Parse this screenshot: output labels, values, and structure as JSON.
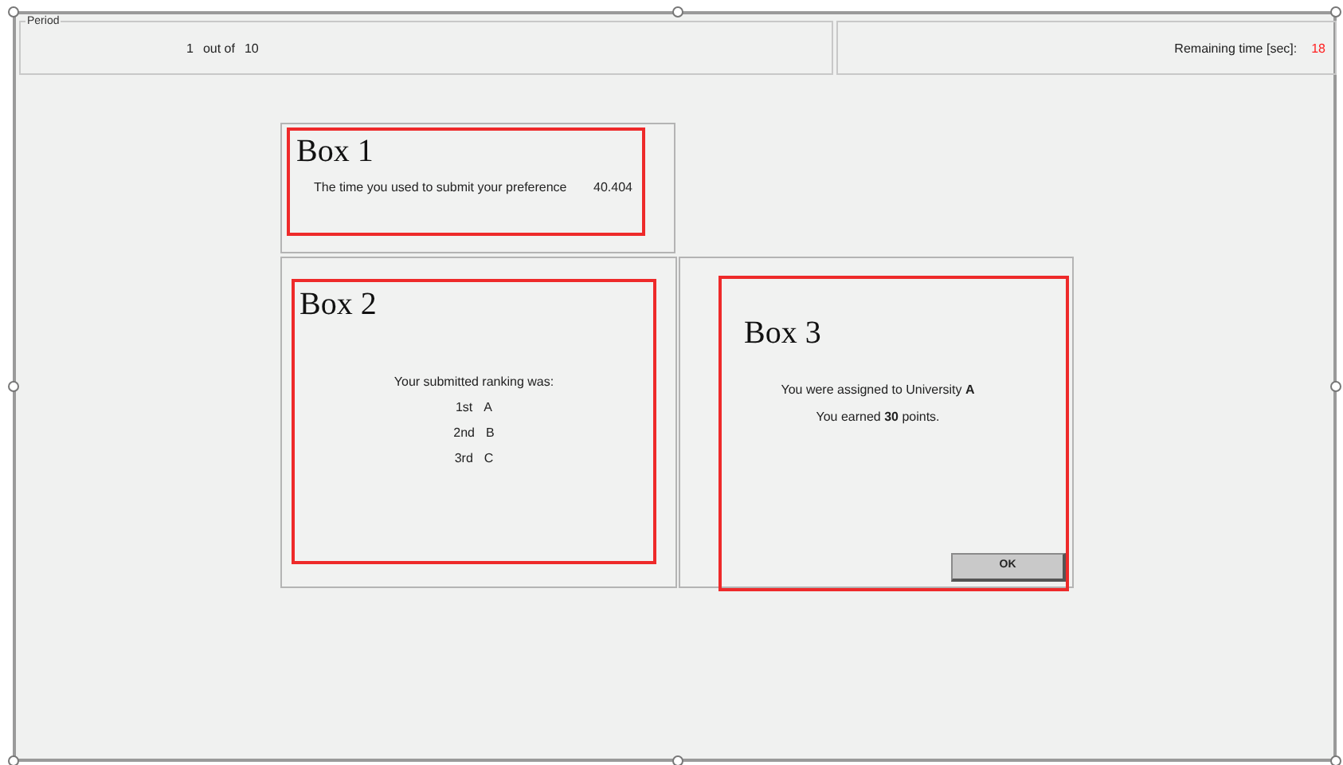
{
  "header": {
    "group_label": "Period",
    "period": "1",
    "out_of": "out of",
    "total": "10",
    "remaining_label": "Remaining time [sec]:",
    "remaining_value": "18"
  },
  "boxes": [
    {
      "kind": "time",
      "annotation": "Box 1",
      "label": "The time you used to submit your preference",
      "value": "40.404"
    },
    {
      "kind": "ranking",
      "annotation": "Box 2",
      "intro": "Your submitted ranking was:",
      "ranking": [
        {
          "rank": "1st",
          "choice": "A"
        },
        {
          "rank": "2nd",
          "choice": "B"
        },
        {
          "rank": "3rd",
          "choice": "C"
        }
      ]
    },
    {
      "kind": "result",
      "annotation": "Box 3",
      "lines": [
        "You were assigned to University **A**",
        "You earned **30** points."
      ],
      "button": "OK"
    }
  ]
}
